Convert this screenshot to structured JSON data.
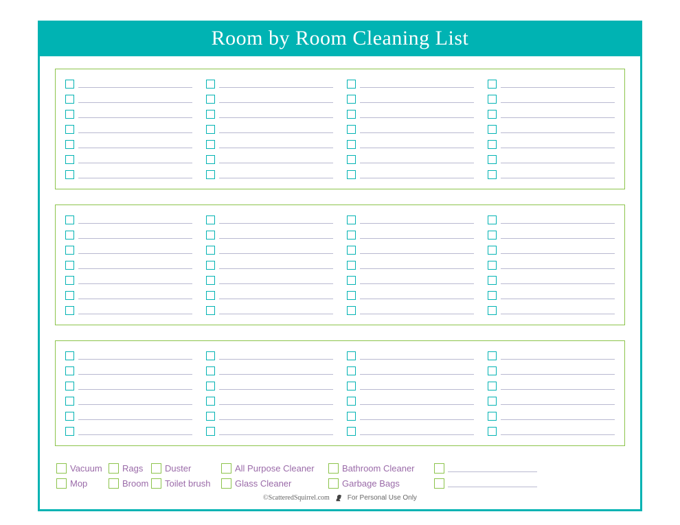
{
  "title": "Room by Room Cleaning List",
  "sections": {
    "count": 3,
    "rows_per_col": [
      7,
      7,
      6
    ],
    "cols": 4
  },
  "supplies": {
    "row1": [
      "Vacuum",
      "Rags",
      "Duster",
      "All Purpose Cleaner",
      "Bathroom Cleaner"
    ],
    "row2": [
      "Mop",
      "Broom",
      "Toilet brush",
      "Glass Cleaner",
      "Garbage Bags"
    ]
  },
  "footer": {
    "copyright": "©ScatteredSquirrel.com",
    "usage": "For Personal Use Only"
  }
}
